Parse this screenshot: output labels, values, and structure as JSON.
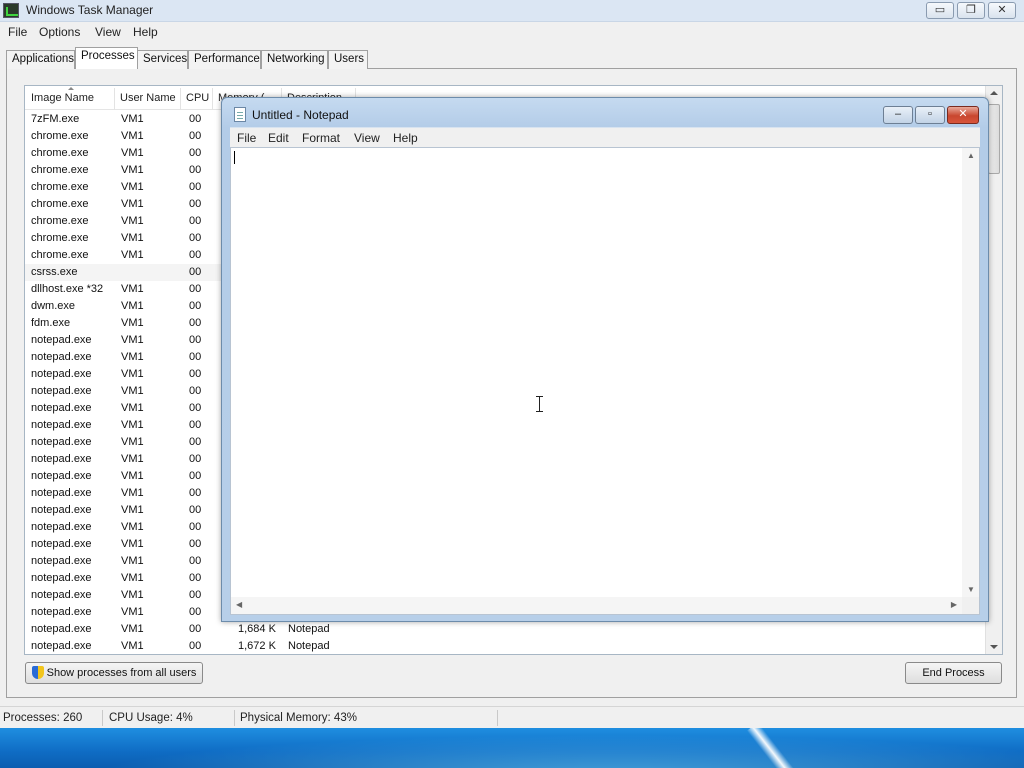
{
  "taskmanager": {
    "title": "Windows Task Manager",
    "caption": {
      "minimize": "▭",
      "restore": "❐",
      "close": "✕"
    },
    "menu": [
      "File",
      "Options",
      "View",
      "Help"
    ],
    "tabs": [
      "Applications",
      "Processes",
      "Services",
      "Performance",
      "Networking",
      "Users"
    ],
    "active_tab": "Processes",
    "columns": [
      "Image Name",
      "User Name",
      "CPU",
      "Memory (...",
      "Description"
    ],
    "rows": [
      {
        "name": "7zFM.exe",
        "user": "VM1",
        "cpu": "00",
        "mem": "",
        "desc": ""
      },
      {
        "name": "chrome.exe",
        "user": "VM1",
        "cpu": "00",
        "mem": "",
        "desc": ""
      },
      {
        "name": "chrome.exe",
        "user": "VM1",
        "cpu": "00",
        "mem": "",
        "desc": ""
      },
      {
        "name": "chrome.exe",
        "user": "VM1",
        "cpu": "00",
        "mem": "",
        "desc": ""
      },
      {
        "name": "chrome.exe",
        "user": "VM1",
        "cpu": "00",
        "mem": "",
        "desc": ""
      },
      {
        "name": "chrome.exe",
        "user": "VM1",
        "cpu": "00",
        "mem": "",
        "desc": ""
      },
      {
        "name": "chrome.exe",
        "user": "VM1",
        "cpu": "00",
        "mem": "",
        "desc": ""
      },
      {
        "name": "chrome.exe",
        "user": "VM1",
        "cpu": "00",
        "mem": "",
        "desc": ""
      },
      {
        "name": "chrome.exe",
        "user": "VM1",
        "cpu": "00",
        "mem": "",
        "desc": ""
      },
      {
        "name": "csrss.exe",
        "user": "",
        "cpu": "00",
        "mem": "",
        "desc": ""
      },
      {
        "name": "dllhost.exe *32",
        "user": "VM1",
        "cpu": "00",
        "mem": "",
        "desc": ""
      },
      {
        "name": "dwm.exe",
        "user": "VM1",
        "cpu": "00",
        "mem": "",
        "desc": ""
      },
      {
        "name": "fdm.exe",
        "user": "VM1",
        "cpu": "00",
        "mem": "",
        "desc": ""
      },
      {
        "name": "notepad.exe",
        "user": "VM1",
        "cpu": "00",
        "mem": "",
        "desc": ""
      },
      {
        "name": "notepad.exe",
        "user": "VM1",
        "cpu": "00",
        "mem": "",
        "desc": ""
      },
      {
        "name": "notepad.exe",
        "user": "VM1",
        "cpu": "00",
        "mem": "",
        "desc": ""
      },
      {
        "name": "notepad.exe",
        "user": "VM1",
        "cpu": "00",
        "mem": "",
        "desc": ""
      },
      {
        "name": "notepad.exe",
        "user": "VM1",
        "cpu": "00",
        "mem": "",
        "desc": ""
      },
      {
        "name": "notepad.exe",
        "user": "VM1",
        "cpu": "00",
        "mem": "",
        "desc": ""
      },
      {
        "name": "notepad.exe",
        "user": "VM1",
        "cpu": "00",
        "mem": "",
        "desc": ""
      },
      {
        "name": "notepad.exe",
        "user": "VM1",
        "cpu": "00",
        "mem": "",
        "desc": ""
      },
      {
        "name": "notepad.exe",
        "user": "VM1",
        "cpu": "00",
        "mem": "",
        "desc": ""
      },
      {
        "name": "notepad.exe",
        "user": "VM1",
        "cpu": "00",
        "mem": "",
        "desc": ""
      },
      {
        "name": "notepad.exe",
        "user": "VM1",
        "cpu": "00",
        "mem": "",
        "desc": ""
      },
      {
        "name": "notepad.exe",
        "user": "VM1",
        "cpu": "00",
        "mem": "",
        "desc": ""
      },
      {
        "name": "notepad.exe",
        "user": "VM1",
        "cpu": "00",
        "mem": "",
        "desc": ""
      },
      {
        "name": "notepad.exe",
        "user": "VM1",
        "cpu": "00",
        "mem": "",
        "desc": ""
      },
      {
        "name": "notepad.exe",
        "user": "VM1",
        "cpu": "00",
        "mem": "",
        "desc": ""
      },
      {
        "name": "notepad.exe",
        "user": "VM1",
        "cpu": "00",
        "mem": "",
        "desc": ""
      },
      {
        "name": "notepad.exe",
        "user": "VM1",
        "cpu": "00",
        "mem": "",
        "desc": ""
      },
      {
        "name": "notepad.exe",
        "user": "VM1",
        "cpu": "00",
        "mem": "1,684 K",
        "desc": "Notepad"
      },
      {
        "name": "notepad.exe",
        "user": "VM1",
        "cpu": "00",
        "mem": "1,672 K",
        "desc": "Notepad"
      }
    ],
    "selected_row": 9,
    "show_all_button": "Show processes from all users",
    "end_process_button": "End Process",
    "status": {
      "processes": "Processes: 260",
      "cpu": "CPU Usage: 4%",
      "memory": "Physical Memory: 43%"
    }
  },
  "notepad": {
    "title": "Untitled - Notepad",
    "menu": [
      "File",
      "Edit",
      "Format",
      "View",
      "Help"
    ],
    "content": ""
  },
  "colors": {
    "desktop": "#1a7fd0",
    "window_bg": "#f0f0f0",
    "notepad_frame": "#b7cfe9",
    "close_button": "#c9472f"
  }
}
